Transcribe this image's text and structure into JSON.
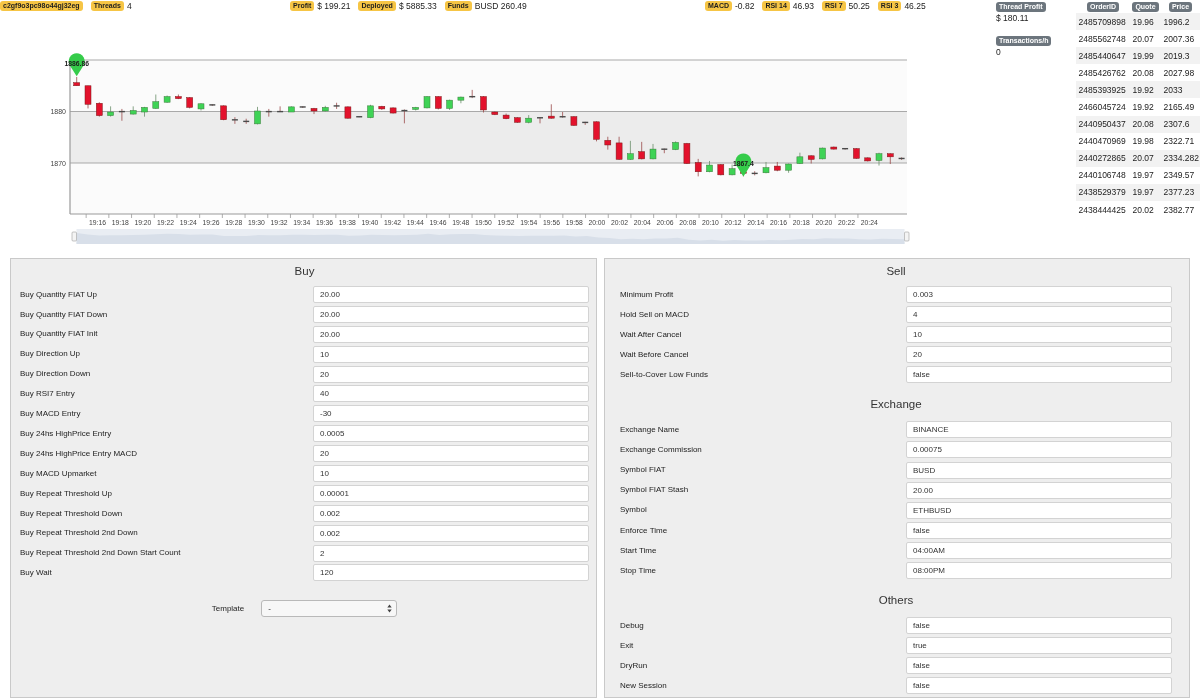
{
  "header": {
    "thread_id": "c2gf9o3pc98o44gj32eg",
    "groups": [
      {
        "stats": [
          {
            "label": "Threads",
            "value": "4"
          }
        ]
      },
      {
        "stats": [
          {
            "label": "Profit",
            "value": "$ 199.21"
          },
          {
            "label": "Deployed",
            "value": "$ 5885.33"
          },
          {
            "label": "Funds",
            "value": "BUSD 260.49"
          }
        ]
      },
      {
        "stats": [
          {
            "label": "MACD",
            "value": "-0.82"
          },
          {
            "label": "RSI 14",
            "value": "46.93"
          },
          {
            "label": "RSI 7",
            "value": "50.25"
          },
          {
            "label": "RSI 3",
            "value": "46.25"
          }
        ]
      }
    ]
  },
  "chart": {
    "y_labels": [
      "1880",
      "1870"
    ],
    "x_labels": [
      "19:16",
      "19:18",
      "19:20",
      "19:22",
      "19:24",
      "19:26",
      "19:28",
      "19:30",
      "19:32",
      "19:34",
      "19:36",
      "19:38",
      "19:40",
      "19:42",
      "19:44",
      "19:46",
      "19:48",
      "19:50",
      "19:52",
      "19:54",
      "19:56",
      "19:58",
      "20:00",
      "20:02",
      "20:04",
      "20:06",
      "20:08",
      "20:10",
      "20:12",
      "20:14",
      "20:16",
      "20:18",
      "20:20",
      "20:22",
      "20:24"
    ],
    "markers": [
      "1886.86",
      "1867.4"
    ]
  },
  "thread_stats": [
    {
      "label": "Thread Profit",
      "value": "$ 180.11"
    },
    {
      "label": "Transactions/h",
      "value": "0"
    }
  ],
  "orders": {
    "columns": [
      "OrderID",
      "Quote",
      "Price"
    ],
    "rows": [
      [
        "2485709898",
        "19.96",
        "1996.2"
      ],
      [
        "2485562748",
        "20.07",
        "2007.36"
      ],
      [
        "2485440647",
        "19.99",
        "2019.3"
      ],
      [
        "2485426762",
        "20.08",
        "2027.98"
      ],
      [
        "2485393925",
        "19.92",
        "2033"
      ],
      [
        "2466045724",
        "19.92",
        "2165.49"
      ],
      [
        "2440950437",
        "20.08",
        "2307.6"
      ],
      [
        "2440470969",
        "19.98",
        "2322.71"
      ],
      [
        "2440272865",
        "20.07",
        "2334.282"
      ],
      [
        "2440106748",
        "19.97",
        "2349.57"
      ],
      [
        "2438529379",
        "19.97",
        "2377.23"
      ],
      [
        "2438444425",
        "20.02",
        "2382.77"
      ]
    ]
  },
  "panels": [
    {
      "sections": [
        {
          "title": "Buy",
          "fields": [
            {
              "label": "Buy Quantity FIAT Up",
              "value": "20.00"
            },
            {
              "label": "Buy Quantity FIAT Down",
              "value": "20.00"
            },
            {
              "label": "Buy Quantity FIAT Init",
              "value": "20.00"
            },
            {
              "label": "Buy Direction Up",
              "value": "10"
            },
            {
              "label": "Buy Direction Down",
              "value": "20"
            },
            {
              "label": "Buy RSI7 Entry",
              "value": "40"
            },
            {
              "label": "Buy MACD Entry",
              "value": "-30"
            },
            {
              "label": "Buy 24hs HighPrice Entry",
              "value": "0.0005"
            },
            {
              "label": "Buy 24hs HighPrice Entry MACD",
              "value": "20"
            },
            {
              "label": "Buy MACD Upmarket",
              "value": "10"
            },
            {
              "label": "Buy Repeat Threshold Up",
              "value": "0.00001"
            },
            {
              "label": "Buy Repeat Threshold Down",
              "value": "0.002"
            },
            {
              "label": "Buy Repeat Threshold 2nd Down",
              "value": "0.002"
            },
            {
              "label": "Buy Repeat Threshold 2nd Down Start Count",
              "value": "2"
            },
            {
              "label": "Buy Wait",
              "value": "120"
            }
          ]
        }
      ],
      "template": {
        "label": "Template",
        "value": "-"
      }
    },
    {
      "sections": [
        {
          "title": "Sell",
          "fields": [
            {
              "label": "Minimum Profit",
              "value": "0.003"
            },
            {
              "label": "Hold Sell on MACD",
              "value": "4"
            },
            {
              "label": "Wait After Cancel",
              "value": "10"
            },
            {
              "label": "Wait Before Cancel",
              "value": "20"
            },
            {
              "label": "Sell-to-Cover Low Funds",
              "value": "false"
            }
          ]
        },
        {
          "title": "Exchange",
          "fields": [
            {
              "label": "Exchange Name",
              "value": "BINANCE"
            },
            {
              "label": "Exchange Commission",
              "value": "0.00075"
            },
            {
              "label": "Symbol FIAT",
              "value": "BUSD"
            },
            {
              "label": "Symbol FIAT Stash",
              "value": "20.00"
            },
            {
              "label": "Symbol",
              "value": "ETHBUSD"
            },
            {
              "label": "Enforce Time",
              "value": "false"
            },
            {
              "label": "Start Time",
              "value": "04:00AM"
            },
            {
              "label": "Stop Time",
              "value": "08:00PM"
            }
          ]
        },
        {
          "title": "Others",
          "fields": [
            {
              "label": "Debug",
              "value": "false"
            },
            {
              "label": "Exit",
              "value": "true"
            },
            {
              "label": "DryRun",
              "value": "false"
            },
            {
              "label": "New Session",
              "value": "false"
            }
          ]
        }
      ]
    }
  ]
}
